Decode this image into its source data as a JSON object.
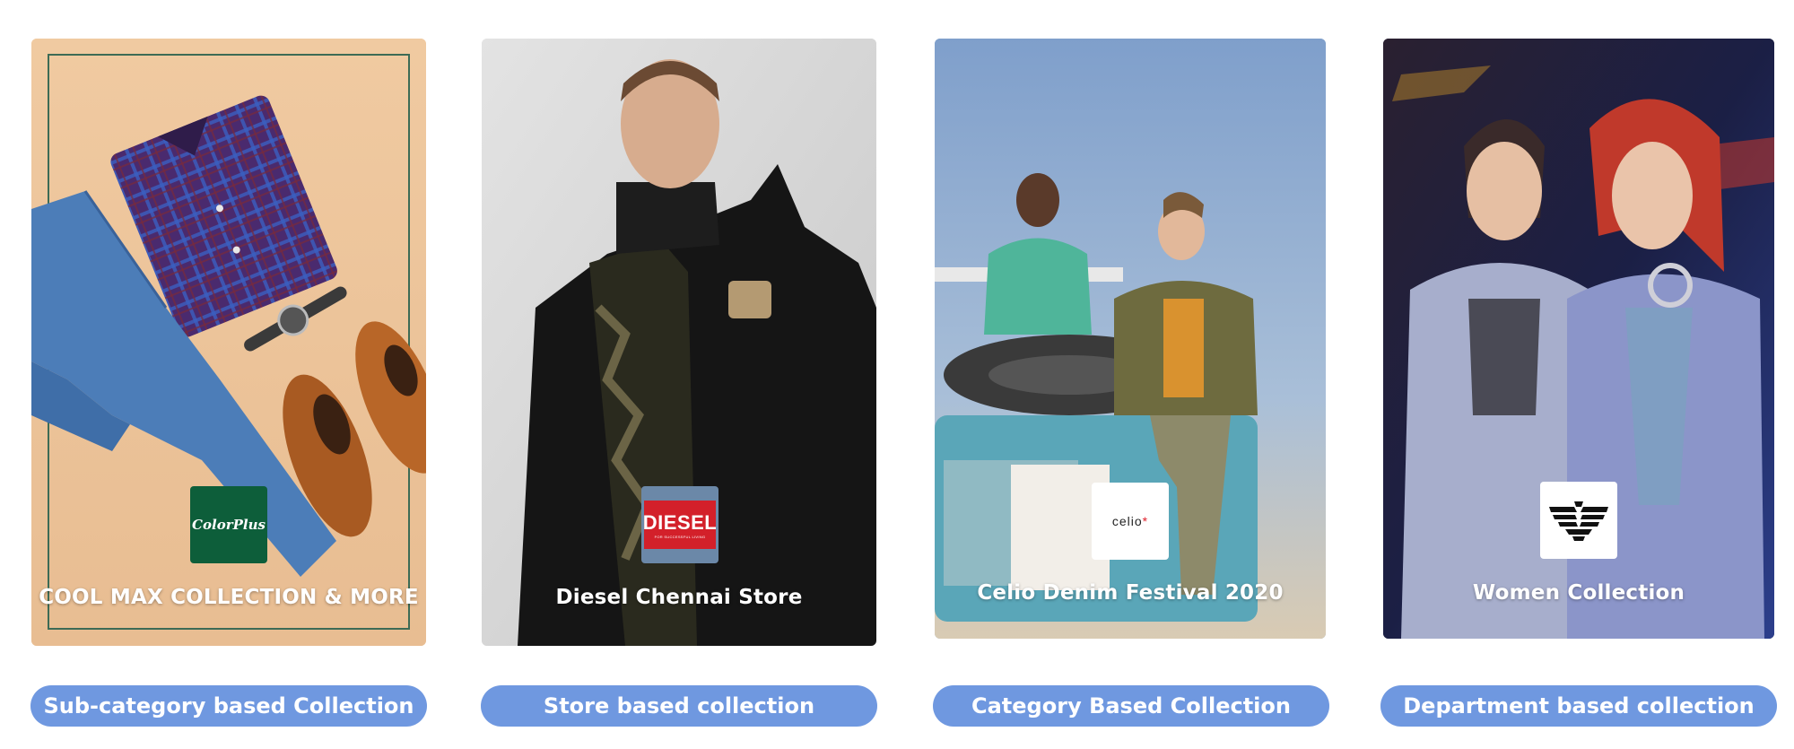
{
  "cards": [
    {
      "title": "COOL MAX COLLECTION & MORE",
      "brand": "ColorPlus",
      "button_label": "Sub-category based Collection",
      "logo_bg": "#0d5e3a",
      "background": "#efc9a0"
    },
    {
      "title": "Diesel Chennai Store",
      "brand": "DIESEL",
      "brand_tagline": "FOR SUCCESSFUL LIVING",
      "button_label": "Store based collection",
      "logo_bg": "#d3202a",
      "background": "#d9d9d9"
    },
    {
      "title": "Celio Denim Festival 2020",
      "brand": "celio",
      "brand_mark": "*",
      "button_label": "Category Based Collection",
      "logo_bg": "#ffffff",
      "background": "#8eaacd"
    },
    {
      "title": "Women Collection",
      "brand": "Emporio Armani eagle",
      "button_label": "Department based collection",
      "logo_bg": "#ffffff",
      "background": "#1a1730"
    }
  ],
  "colors": {
    "pill": "#6f98e0",
    "pill_text": "#ffffff"
  }
}
